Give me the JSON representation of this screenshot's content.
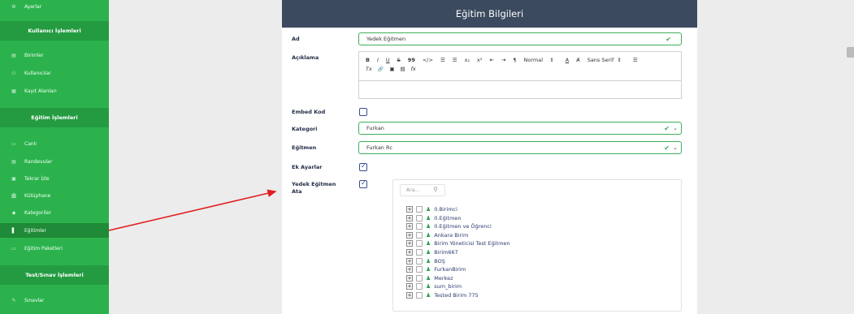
{
  "sidebar": {
    "items": [
      {
        "label": "Ayarlar",
        "icon": "gear-icon"
      },
      {
        "label": "Birimler",
        "icon": "table-icon"
      },
      {
        "label": "Kullanıcılar",
        "icon": "users-icon"
      },
      {
        "label": "Kayıt Alanları",
        "icon": "table-icon"
      },
      {
        "label": "Canlı",
        "icon": "video-icon"
      },
      {
        "label": "Randevular",
        "icon": "calendar-icon"
      },
      {
        "label": "Tekrar İzle",
        "icon": "replay-icon"
      },
      {
        "label": "Kütüphane",
        "icon": "library-icon"
      },
      {
        "label": "Kategoriler",
        "icon": "tag-icon"
      },
      {
        "label": "Eğitimler",
        "icon": "book-icon"
      },
      {
        "label": "Eğitim Paketleri",
        "icon": "package-icon"
      },
      {
        "label": "Sınavlar",
        "icon": "edit-icon"
      }
    ],
    "headers": {
      "kullanici": "Kullanıcı İşlemleri",
      "egitim": "Eğitim İşlemleri",
      "test": "Test/Sınav İşlemleri"
    }
  },
  "panel": {
    "title": "Eğitim Bilgileri",
    "labels": {
      "ad": "Ad",
      "aciklama": "Açıklama",
      "embed": "Embed Kod",
      "kategori": "Kategori",
      "egitmen": "Eğitmen",
      "ek_ayarlar": "Ek Ayarlar",
      "yedek_line1": "Yedek Eğitmen",
      "yedek_line2": "Ata"
    },
    "values": {
      "ad": "Yedek Eğitmen",
      "kategori": "Furkan",
      "egitmen": "Furkan Rc"
    },
    "toolbar": {
      "row1": [
        "B",
        "I",
        "U",
        "S",
        "99",
        "</>",
        "☰",
        "☰",
        "x₂",
        "x²",
        "⇤",
        "⇥",
        "¶"
      ],
      "normal": "Normal",
      "font": "Sans Serif",
      "row2": [
        "Tx",
        "🔗",
        "▣",
        "▤",
        "fx"
      ]
    },
    "search_placeholder": "Ara...",
    "tree": [
      "0.Birimci",
      "0.Eğitmen",
      "0.Eğitmen ve Öğrenci",
      "Ankara Birim",
      "Birim Yöneticisi Test Eğitmen",
      "Birim667",
      "BOŞ",
      "FurkanBirim",
      "Merkez",
      "sum_birim",
      "Tested Birim 775"
    ]
  },
  "colors": {
    "sidebar": "#2bb24c",
    "header": "#3b4a5e",
    "accent": "#2b3f86",
    "arrow": "#e11d1d"
  }
}
